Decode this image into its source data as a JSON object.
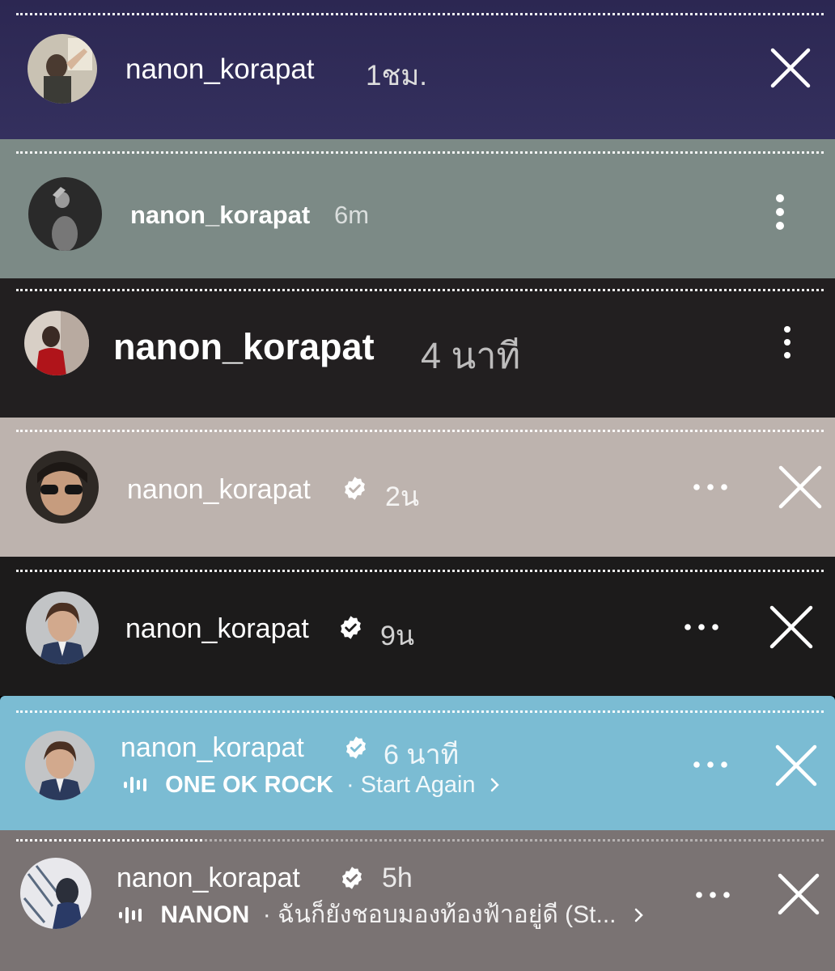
{
  "stories": [
    {
      "bg": "#2f2a57",
      "username": "nanon_korapat",
      "time": "1ชม.",
      "controls": [
        "close"
      ]
    },
    {
      "bg": "#7c8a86",
      "username": "nanon_korapat",
      "time": "6m",
      "controls": [
        "more-vertical"
      ]
    },
    {
      "bg": "#221f20",
      "username": "nanon_korapat",
      "time": "4 นาที",
      "controls": [
        "more-vertical"
      ]
    },
    {
      "bg": "#bdb3ae",
      "username": "nanon_korapat",
      "verified": true,
      "time": "2น",
      "controls": [
        "more-horizontal",
        "close"
      ]
    },
    {
      "bg": "#1c1b1b",
      "username": "nanon_korapat",
      "verified": true,
      "time": "9น",
      "controls": [
        "more-horizontal",
        "close"
      ]
    },
    {
      "bg": "#7bbcd3",
      "username": "nanon_korapat",
      "verified": true,
      "time": "6 นาที",
      "music_artist": "ONE OK ROCK",
      "music_track": "· Start Again",
      "controls": [
        "more-horizontal",
        "close"
      ]
    },
    {
      "bg": "#7a7373",
      "username": "nanon_korapat",
      "verified": true,
      "time": "5h",
      "music_artist": "NANON",
      "music_track": "· ฉันก็ยังชอบมองท้องฟ้าอยู่ดี (St...",
      "controls": [
        "more-horizontal",
        "close"
      ]
    }
  ],
  "icons": {
    "close": "close-icon",
    "more_vertical": "more-vertical-icon",
    "more_horizontal": "more-horizontal-icon",
    "verified": "verified-badge-icon",
    "music": "music-equalizer-icon",
    "chevron": "chevron-right-icon"
  }
}
